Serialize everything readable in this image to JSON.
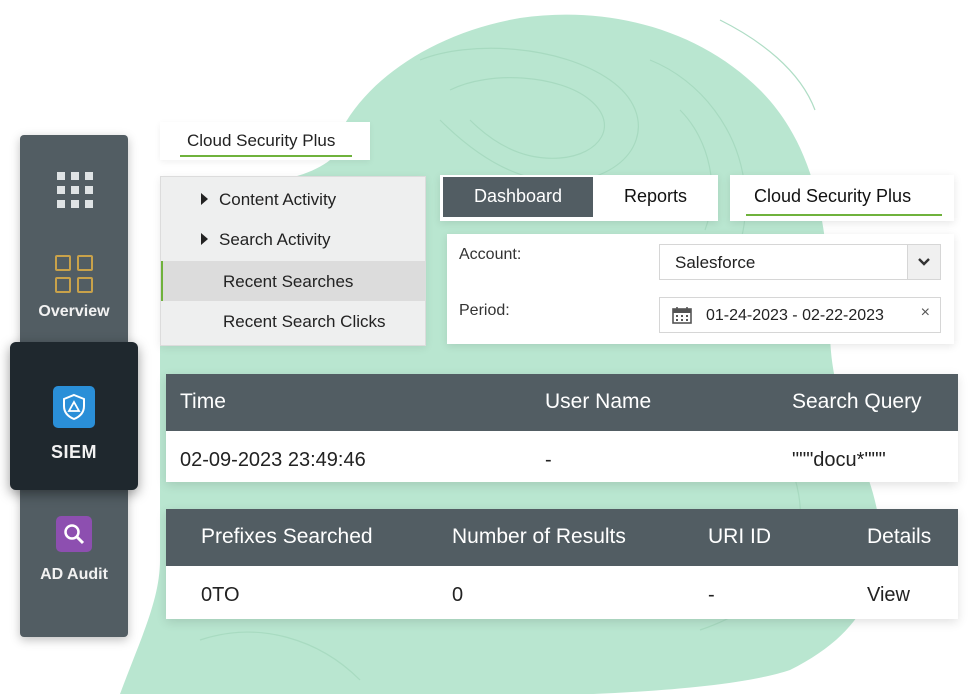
{
  "colors": {
    "sidebar_bg": "#525d63",
    "sidebar_active_bg": "#1f282e",
    "accent_green": "#6fb23c",
    "table_header_bg": "#525d63",
    "link_blue": "#2b7fc2",
    "background_blob": "#b9e6d0"
  },
  "sidebar": {
    "items": [
      {
        "label": "",
        "icon": "apps-grid-icon"
      },
      {
        "label": "Overview",
        "icon": "overview-icon"
      },
      {
        "label": "SIEM",
        "icon": "shield-icon",
        "active": true
      },
      {
        "label": "AD Audit",
        "icon": "search-icon"
      }
    ]
  },
  "top_tab": {
    "label": "Cloud Security Plus"
  },
  "menu": {
    "items": [
      {
        "label": "Content Activity",
        "expandable": true
      },
      {
        "label": "Search Activity",
        "expandable": true
      },
      {
        "label": "Recent Searches",
        "active": true
      },
      {
        "label": "Recent Search Clicks"
      }
    ]
  },
  "tabs": {
    "dashboard": "Dashboard",
    "reports": "Reports",
    "cloud_security_plus": "Cloud Security Plus"
  },
  "filters": {
    "account_label": "Account:",
    "account_value": "Salesforce",
    "period_label": "Period:",
    "period_value": "01-24-2023 - 02-22-2023",
    "clear_symbol": "×"
  },
  "table1": {
    "headers": [
      "Time",
      "User Name",
      "Search Query"
    ],
    "rows": [
      [
        "02-09-2023 23:49:46",
        "-",
        "\"\"\"docu*\"\"\""
      ]
    ]
  },
  "table2": {
    "headers": [
      "Prefixes Searched",
      "Number of Results",
      "URI ID",
      "Details"
    ],
    "rows": [
      [
        "0TO",
        "0",
        "-",
        "View"
      ]
    ]
  }
}
